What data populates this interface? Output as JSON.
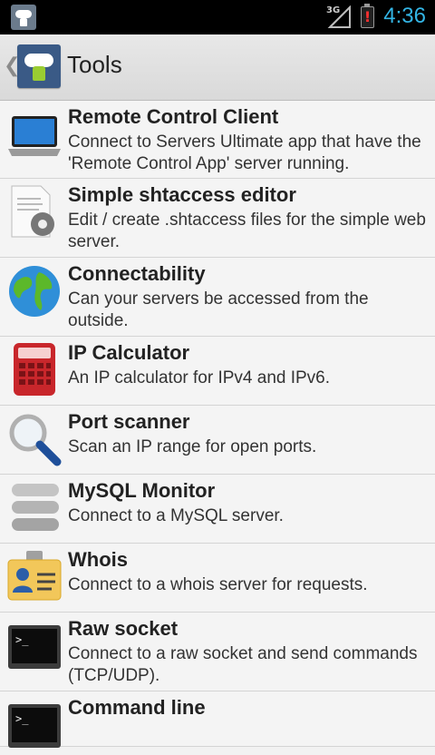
{
  "status_bar": {
    "network": "3G",
    "battery_icon": "battery-alert-icon",
    "time": "4:36",
    "time_color": "#33b5e5"
  },
  "action_bar": {
    "title": "Tools",
    "back_icon": "chevron-left-icon",
    "logo_icon": "cloud-android-logo"
  },
  "items": [
    {
      "icon": "laptop-icon",
      "title": "Remote Control Client",
      "desc": "Connect to Servers Ultimate app that have the 'Remote Control App' server running."
    },
    {
      "icon": "document-gear-icon",
      "title": "Simple shtaccess editor",
      "desc": "Edit / create .shtaccess files for the simple web server."
    },
    {
      "icon": "globe-icon",
      "title": "Connectability",
      "desc": "Can your servers be accessed from the outside."
    },
    {
      "icon": "calculator-icon",
      "title": "IP Calculator",
      "desc": "An IP calculator for IPv4 and IPv6."
    },
    {
      "icon": "magnifier-icon",
      "title": "Port scanner",
      "desc": "Scan an IP range for open ports."
    },
    {
      "icon": "database-icon",
      "title": "MySQL Monitor",
      "desc": "Connect to a MySQL server."
    },
    {
      "icon": "id-card-icon",
      "title": "Whois",
      "desc": "Connect to a whois server for requests."
    },
    {
      "icon": "terminal-icon",
      "title": "Raw socket",
      "desc": "Connect to a raw socket and send commands (TCP/UDP)."
    },
    {
      "icon": "terminal-icon",
      "title": "Command line",
      "desc": ""
    }
  ]
}
